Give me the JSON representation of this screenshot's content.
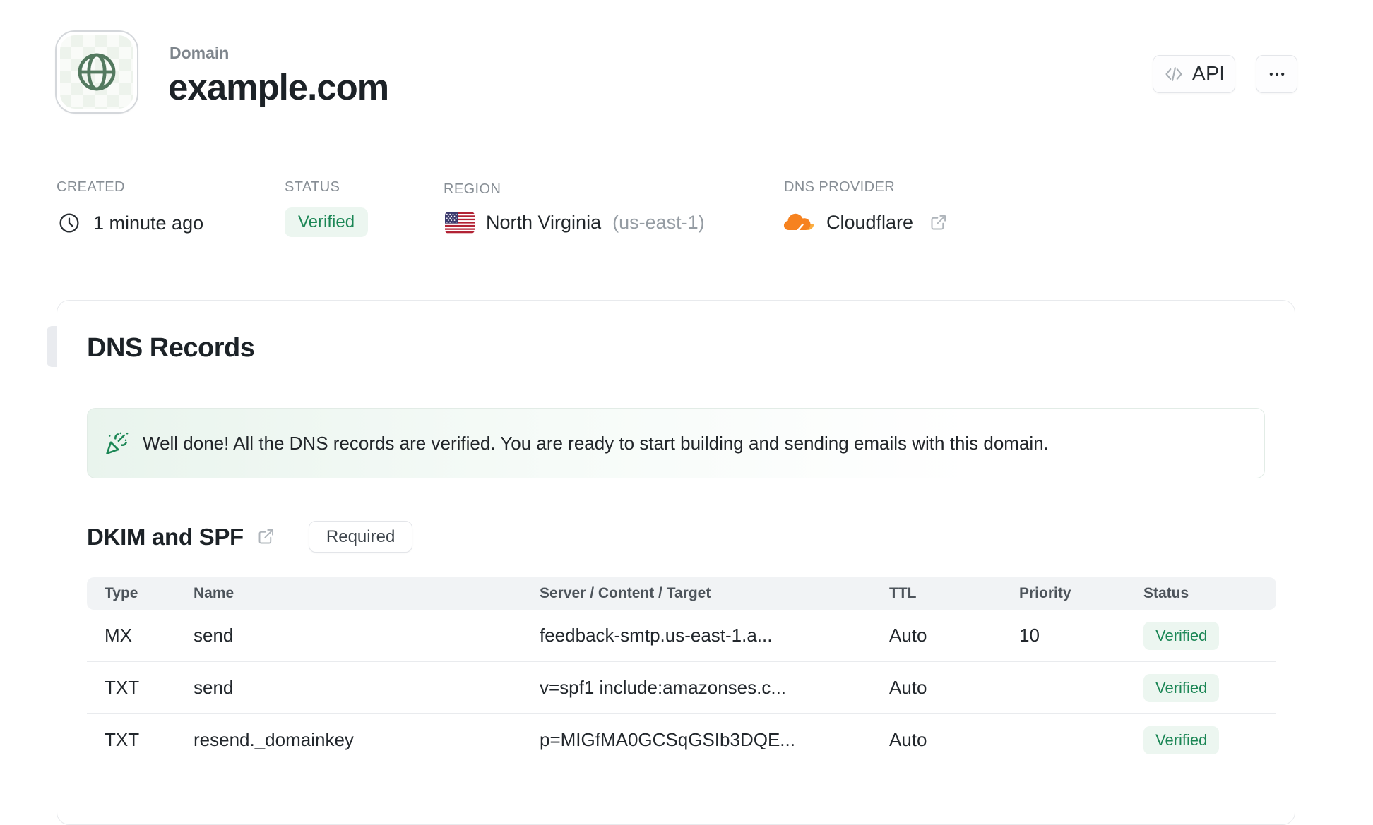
{
  "header": {
    "eyebrow": "Domain",
    "title": "example.com",
    "api_button": "API"
  },
  "meta": {
    "created_label": "CREATED",
    "created_value": "1 minute ago",
    "status_label": "STATUS",
    "status_value": "Verified",
    "region_label": "REGION",
    "region_value": "North Virginia",
    "region_code": "(us-east-1)",
    "provider_label": "DNS PROVIDER",
    "provider_value": "Cloudflare"
  },
  "records": {
    "heading": "DNS Records",
    "banner_text": "Well done! All the DNS records are verified. You are ready to start building and sending emails with this domain.",
    "section_title": "DKIM and SPF",
    "section_badge": "Required",
    "table": {
      "headers": [
        "Type",
        "Name",
        "Server / Content / Target",
        "TTL",
        "Priority",
        "Status"
      ],
      "rows": [
        {
          "type": "MX",
          "name": "send",
          "content": "feedback-smtp.us-east-1.a...",
          "ttl": "Auto",
          "priority": "10",
          "status": "Verified"
        },
        {
          "type": "TXT",
          "name": "send",
          "content": "v=spf1 include:amazonses.c...",
          "ttl": "Auto",
          "priority": "",
          "status": "Verified"
        },
        {
          "type": "TXT",
          "name": "resend._domainkey",
          "content": "p=MIGfMA0GCSqGSIb3DQE...",
          "ttl": "Auto",
          "priority": "",
          "status": "Verified"
        }
      ]
    }
  },
  "colors": {
    "verified_green": "#1b8655",
    "verified_bg": "#ecf6f0",
    "cloudflare_orange": "#f6821f",
    "globe_green": "#53795f"
  }
}
